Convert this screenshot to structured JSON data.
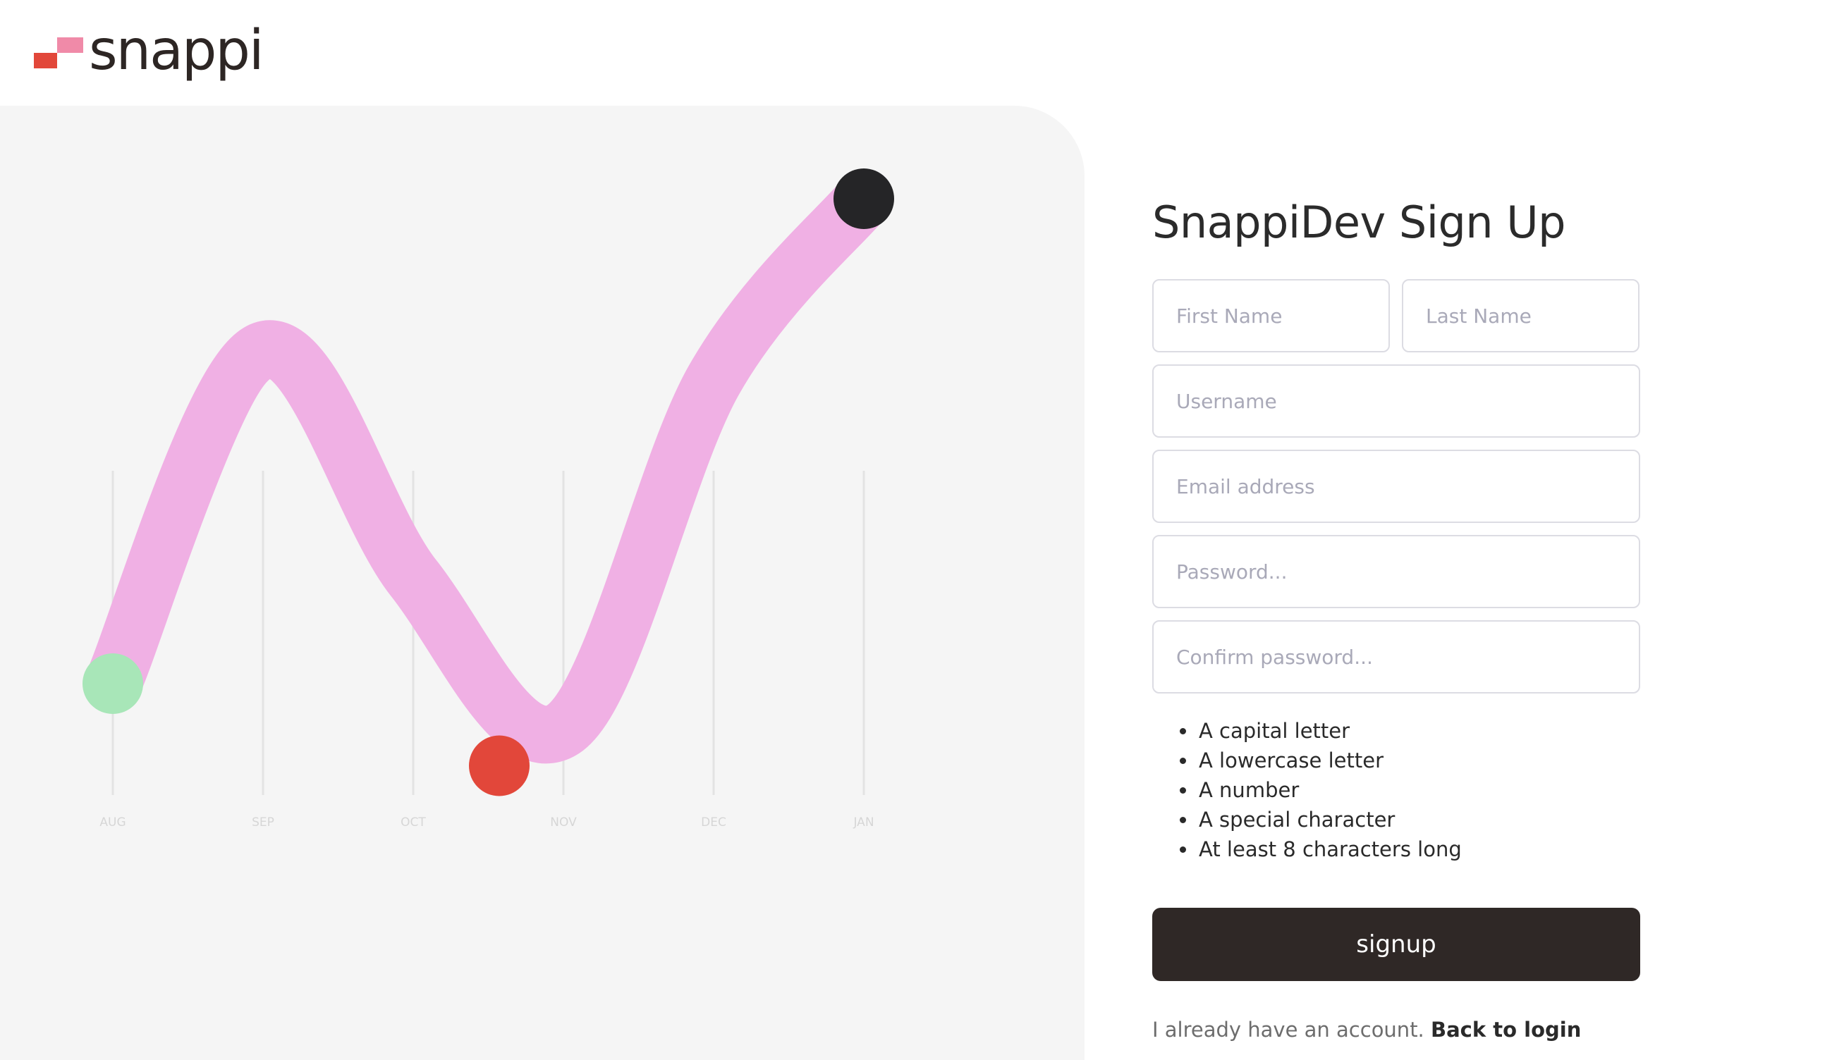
{
  "brand": {
    "name": "snappi",
    "colors": {
      "mark_red": "#e2473a",
      "mark_pink": "#f08aa8",
      "text": "#2d2624"
    }
  },
  "chart_data": {
    "type": "line",
    "categories": [
      "AUG",
      "SEP",
      "OCT",
      "NOV",
      "DEC",
      "JAN"
    ],
    "series": [
      {
        "values": [
          1.0,
          2.1,
          1.35,
          0.85,
          2.0,
          2.6
        ]
      }
    ],
    "markers": [
      {
        "category": "AUG",
        "value": 1.0,
        "color": "#a8e6b8"
      },
      {
        "category": "OCT",
        "value": 0.85,
        "color": "#e2473a"
      },
      {
        "category": "JAN",
        "value": 2.6,
        "color": "#252527"
      }
    ],
    "line_color": "#f0b0e4",
    "grid": true,
    "ylim": [
      0,
      3
    ]
  },
  "form": {
    "title": "SnappiDev Sign Up",
    "first_name_placeholder": "First Name",
    "last_name_placeholder": "Last Name",
    "username_placeholder": "Username",
    "email_placeholder": "Email address",
    "password_placeholder": "Password...",
    "confirm_placeholder": "Confirm password...",
    "rules": [
      "A capital letter",
      "A lowercase letter",
      "A number",
      "A special character",
      "At least 8 characters long"
    ],
    "submit_label": "signup",
    "login_prompt": "I already have an account.",
    "login_link": "Back to login"
  }
}
